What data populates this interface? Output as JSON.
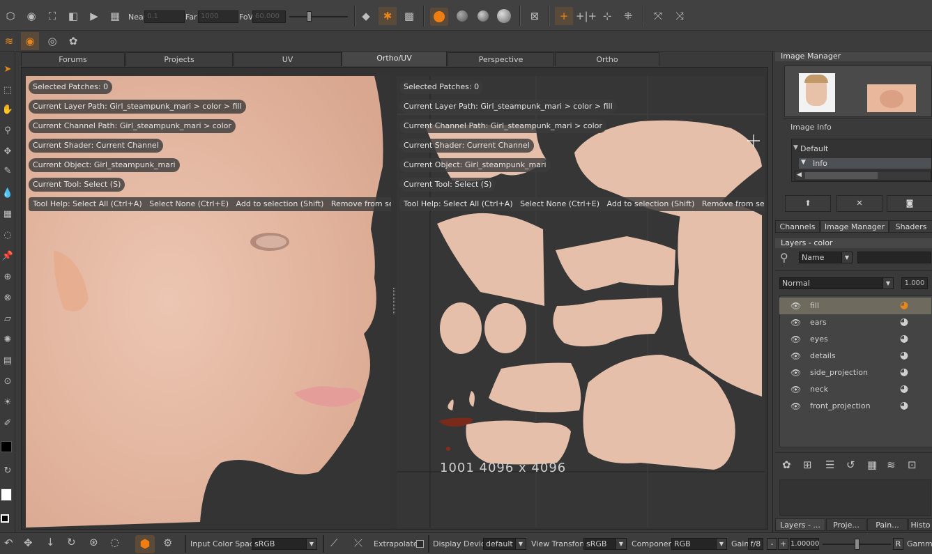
{
  "toolbar": {
    "near_label": "Near",
    "near_value": "0.1",
    "far_label": "Far",
    "far_value": "1000",
    "fov_label": "FoV",
    "fov_value": "60.000"
  },
  "tabs": [
    {
      "label": "Forums"
    },
    {
      "label": "Projects"
    },
    {
      "label": "UV"
    },
    {
      "label": "Ortho/UV"
    },
    {
      "label": "Perspective"
    },
    {
      "label": "Ortho"
    }
  ],
  "hud": {
    "selected_patches": "Selected Patches: 0",
    "layer_path": "Current Layer Path: Girl_steampunk_mari > color > fill",
    "channel_path": "Current Channel Path: Girl_steampunk_mari > color",
    "shader": "Current Shader: Current Channel",
    "object": "Current Object: Girl_steampunk_mari",
    "tool": "Current Tool: Select (S)",
    "tool_help": "Tool Help: Select All (Ctrl+A)   Select None (Ctrl+E)   Add to selection (Shift)   Remove from selection (Ctrl)"
  },
  "uv_label": "1001 4096 x 4096",
  "image_manager": {
    "title": "Image Manager",
    "image_info_label": "Image Info",
    "tree_default": "Default",
    "tree_info": "Info"
  },
  "panel_tabs": [
    {
      "label": "Channels"
    },
    {
      "label": "Image Manager"
    },
    {
      "label": "Shaders"
    }
  ],
  "layers": {
    "title": "Layers - color",
    "filter_field": "Name",
    "blend_mode": "Normal",
    "opacity": "1.000",
    "items": [
      {
        "name": "fill"
      },
      {
        "name": "ears"
      },
      {
        "name": "eyes"
      },
      {
        "name": "details"
      },
      {
        "name": "side_projection"
      },
      {
        "name": "neck"
      },
      {
        "name": "front_projection"
      }
    ]
  },
  "bottom_tabs": [
    {
      "label": "Layers - ..."
    },
    {
      "label": "Proje..."
    },
    {
      "label": "Pain..."
    },
    {
      "label": "Histo"
    }
  ],
  "status": {
    "input_color_space_label": "Input Color Space",
    "input_color_space_value": "sRGB",
    "extrapolate_label": "Extrapolate",
    "display_device_label": "Display Device",
    "display_device_value": "default",
    "view_transform_label": "View Transform",
    "view_transform_value": "sRGB",
    "component_label": "Component",
    "component_value": "RGB",
    "gain_label": "Gain",
    "gain_value": "f/8",
    "gain_minus": "-",
    "gain_plus": "+",
    "exposure_value": "1.00000",
    "r_label": "R",
    "gamma_label": "Gamma"
  },
  "colors": {
    "accent": "#e8861a",
    "skin": "#e4b9a3",
    "panel": "#3a3a3a"
  }
}
